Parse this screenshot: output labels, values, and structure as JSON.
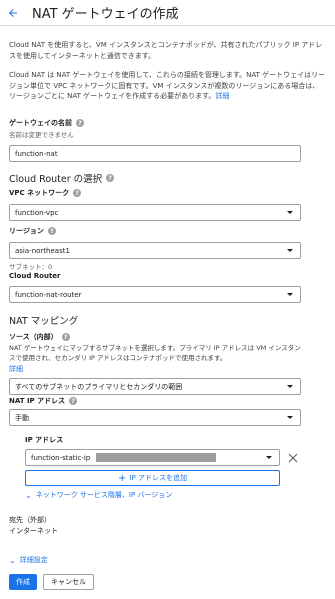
{
  "header": {
    "title": "NAT ゲートウェイの作成"
  },
  "intro": {
    "p1": "Cloud NAT を使用すると、VM インスタンスとコンテナポッドが、共有されたパブリック IP アドレスを使用してインターネットと通信できます。",
    "p2": "Cloud NAT は NAT ゲートウェイを使用して、これらの接続を管理します。NAT ゲートウェイはリージョン単位で VPC ネットワークに固有です。VM インスタンスが複数のリージョンにある場合は、リージョンごとに NAT ゲートウェイを作成する必要があります。",
    "details_link": "詳細"
  },
  "gateway_name": {
    "label": "ゲートウェイの名前",
    "note": "名前は変更できません",
    "value": "function-nat"
  },
  "router_section": {
    "title": "Cloud Router の選択",
    "network": {
      "label": "VPC ネットワーク",
      "value": "function-vpc"
    },
    "region": {
      "label": "リージョン",
      "value": "asia-northeast1",
      "subnet_count": "サブネット：0"
    },
    "router": {
      "label": "Cloud Router",
      "value": "function-nat-router"
    }
  },
  "nat_mapping": {
    "title": "NAT マッピング",
    "source_label": "ソース（内部）",
    "source_desc": "NAT ゲートウェイにマップするサブネットを選択します。プライマリ IP アドレスは VM インスタンスで使用され、セカンダリ IP アドレスはコンテナポッドで使用されます。",
    "source_link": "詳細",
    "source_value": "すべてのサブネットのプライマリとセカンダリの範囲",
    "ip_label": "NAT IP アドレス",
    "ip_mode": "手動",
    "ip_address_label": "IP アドレス",
    "ip_value": "function-static-ip",
    "add_ip_button": "IP アドレスを追加",
    "tier_link": "ネットワーク サービス階層、IP バージョン",
    "dest_label": "宛先（外部）",
    "dest_value": "インターネット"
  },
  "advanced_link": "詳細設定",
  "actions": {
    "create": "作成",
    "cancel": "キャンセル"
  },
  "colors": {
    "accent": "#1a73e8",
    "border": "#9aa0a6",
    "text": "#202124"
  }
}
